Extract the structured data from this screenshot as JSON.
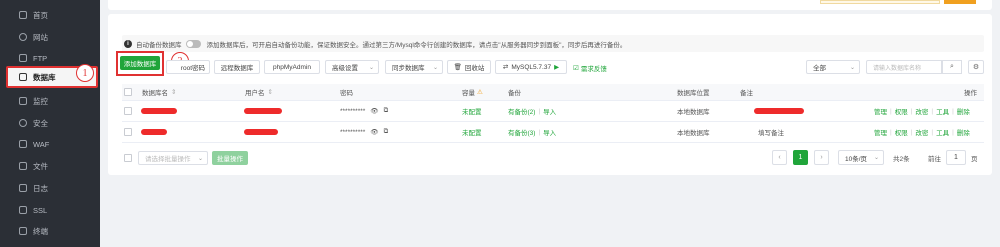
{
  "sidebar": {
    "items": [
      {
        "label": "首页",
        "icon": "home-icon"
      },
      {
        "label": "网站",
        "icon": "globe-icon"
      },
      {
        "label": "FTP",
        "icon": "ftp-icon"
      },
      {
        "label": "数据库",
        "icon": "database-icon",
        "active": true
      },
      {
        "label": "监控",
        "icon": "monitor-icon"
      },
      {
        "label": "安全",
        "icon": "shield-icon"
      },
      {
        "label": "WAF",
        "icon": "waf-icon"
      },
      {
        "label": "文件",
        "icon": "folder-icon"
      },
      {
        "label": "日志",
        "icon": "log-icon"
      },
      {
        "label": "SSL",
        "icon": "ssl-icon"
      },
      {
        "label": "终端",
        "icon": "terminal-icon"
      }
    ]
  },
  "annotations": {
    "badge1": "1",
    "badge2": "2"
  },
  "notice": {
    "toggle_label": "自动备份数据库",
    "text": "添加数据库后，可开启自动备份功能，保证数据安全。通过第三方/Mysql命令行创建的数据库，请点击\"从服务器同步到面板\"，同步后再进行备份。"
  },
  "toolbar": {
    "add_db": "添加数据库",
    "root_pwd": "root密码",
    "remote_db": "远程数据库",
    "phpmyadmin": "phpMyAdmin",
    "advanced": "高级设置",
    "sync": "同步数据库",
    "recycle": "回收站",
    "mysql_version": "MySQL5.7.37",
    "feedback": "需求反馈",
    "filter_all": "全部",
    "search_placeholder": "请输入数据库名称"
  },
  "table": {
    "headers": {
      "name": "数据库名",
      "user": "用户名",
      "password": "密码",
      "capacity": "容量",
      "backup": "备份",
      "location": "数据库位置",
      "remark": "备注",
      "actions": "操作"
    },
    "rows": [
      {
        "password": "**********",
        "capacity": "未配置",
        "backup": "有备份(2)",
        "import": "导入",
        "location": "本地数据库",
        "remark": ""
      },
      {
        "password": "**********",
        "capacity": "未配置",
        "backup": "有备份(3)",
        "import": "导入",
        "location": "本地数据库",
        "remark": "填写备注"
      }
    ],
    "action_labels": [
      "管理",
      "权限",
      "改密",
      "工具",
      "删除"
    ]
  },
  "footer": {
    "batch_select": "请选择批量操作",
    "batch_button": "批量操作",
    "current_page": "1",
    "per_page": "10条/页",
    "total": "共2条",
    "goto_label": "前往",
    "goto_value": "1",
    "page_unit": "页"
  },
  "colors": {
    "accent": "#20a53a",
    "highlight": "#e03131",
    "sidebar": "#2b2f36"
  }
}
